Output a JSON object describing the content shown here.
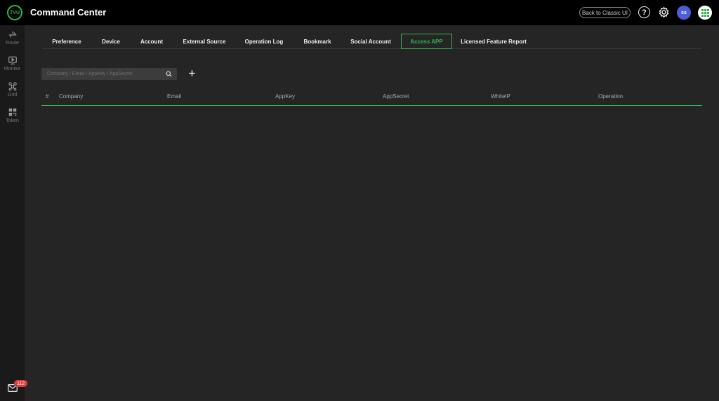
{
  "header": {
    "logo_text": "TVU",
    "title": "Command Center",
    "back_button": "Back to Classic UI",
    "help_icon": "question-circle",
    "settings_icon": "gear",
    "avatar_initials": "cs",
    "apps_icon": "grid-apps"
  },
  "sidebar": {
    "items": [
      {
        "label": "Route",
        "icon": "route-icon"
      },
      {
        "label": "Monitor",
        "icon": "monitor-icon"
      },
      {
        "label": "Grid",
        "icon": "grid-network-icon"
      },
      {
        "label": "Token",
        "icon": "qr-token-icon"
      }
    ],
    "mail_badge": "112"
  },
  "tabs": [
    {
      "label": "Preference"
    },
    {
      "label": "Device"
    },
    {
      "label": "Account"
    },
    {
      "label": "External Source"
    },
    {
      "label": "Operation Log"
    },
    {
      "label": "Bookmark"
    },
    {
      "label": "Social Account"
    },
    {
      "label": "Access APP",
      "active": true
    },
    {
      "label": "Licensed Feature Report"
    }
  ],
  "search": {
    "placeholder": "Company / Email / AppKey / AppSecret",
    "value": ""
  },
  "add_button": "+",
  "table": {
    "columns": [
      "#",
      "Company",
      "Email",
      "AppKey",
      "AppSecret",
      "WhiteIP",
      "Operation"
    ],
    "rows": []
  },
  "colors": {
    "accent": "#33b34a",
    "background": "#252525",
    "topbar": "#000000",
    "sidebar": "#1a1a1a",
    "badge": "#e03b3b",
    "avatar": "#4d5dd6"
  }
}
